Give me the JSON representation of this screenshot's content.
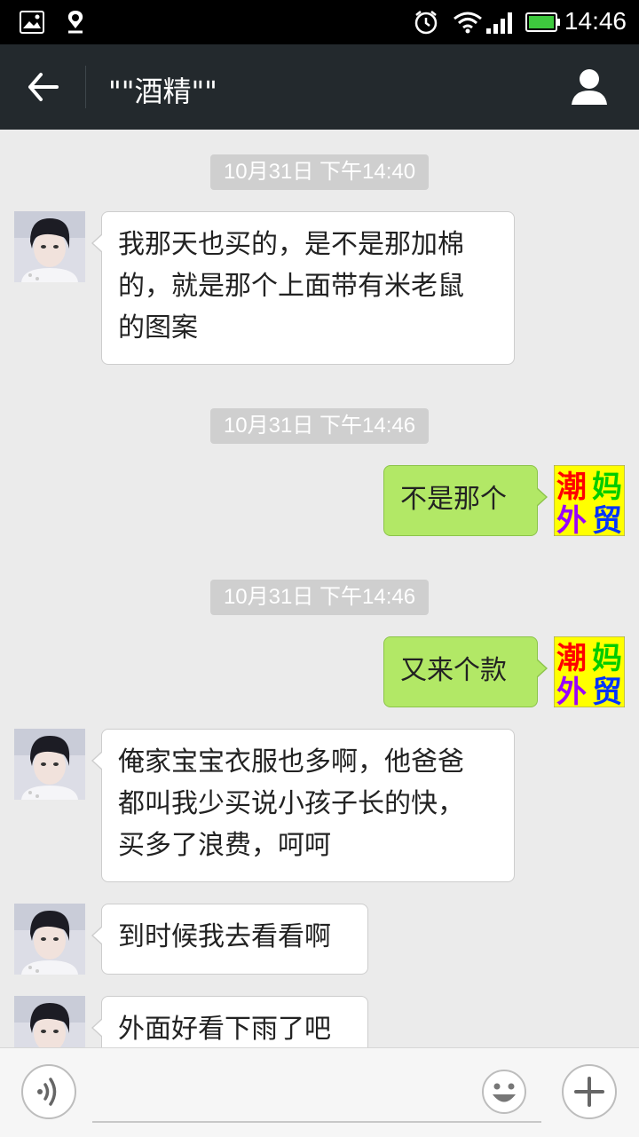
{
  "status_bar": {
    "time": "14:46",
    "icons": [
      "gallery-icon",
      "notification-icon",
      "alarm-icon",
      "wifi-icon",
      "signal-icon",
      "battery-icon"
    ]
  },
  "header": {
    "title": "\"\"酒精\"\"",
    "back_icon": "back-arrow-icon",
    "profile_icon": "profile-icon"
  },
  "messages": [
    {
      "type": "timestamp",
      "text": "10月31日 下午14:40"
    },
    {
      "type": "incoming",
      "lines": [
        "我那天也买的，是不是那加棉",
        "的，就是那个上面带有米老鼠",
        "的图案"
      ]
    },
    {
      "type": "timestamp",
      "text": "10月31日 下午14:46"
    },
    {
      "type": "outgoing",
      "lines": [
        "不是那个"
      ]
    },
    {
      "type": "timestamp",
      "text": "10月31日 下午14:46"
    },
    {
      "type": "outgoing",
      "lines": [
        "又来个款"
      ]
    },
    {
      "type": "incoming",
      "lines": [
        "俺家宝宝衣服也多啊，他爸爸",
        "都叫我少买说小孩子长的快，",
        "买多了浪费，呵呵"
      ]
    },
    {
      "type": "incoming",
      "lines": [
        "到时候我去看看啊"
      ]
    },
    {
      "type": "incoming",
      "lines": [
        "外面好看下雨了吧"
      ]
    }
  ],
  "self_avatar": {
    "chars": [
      "潮",
      "妈",
      "外",
      "贸"
    ],
    "colors": [
      "#ff0000",
      "#00cc00",
      "#9900ff",
      "#0033ff"
    ],
    "background": "#ffff00"
  },
  "input_bar": {
    "voice_icon": "voice-icon",
    "emoji_icon": "emoji-icon",
    "plus_icon": "plus-icon"
  },
  "colors": {
    "titlebar": "#23292d",
    "chat_bg": "#ebebeb",
    "outgoing_bubble": "#b2e866",
    "incoming_bubble": "#ffffff"
  }
}
